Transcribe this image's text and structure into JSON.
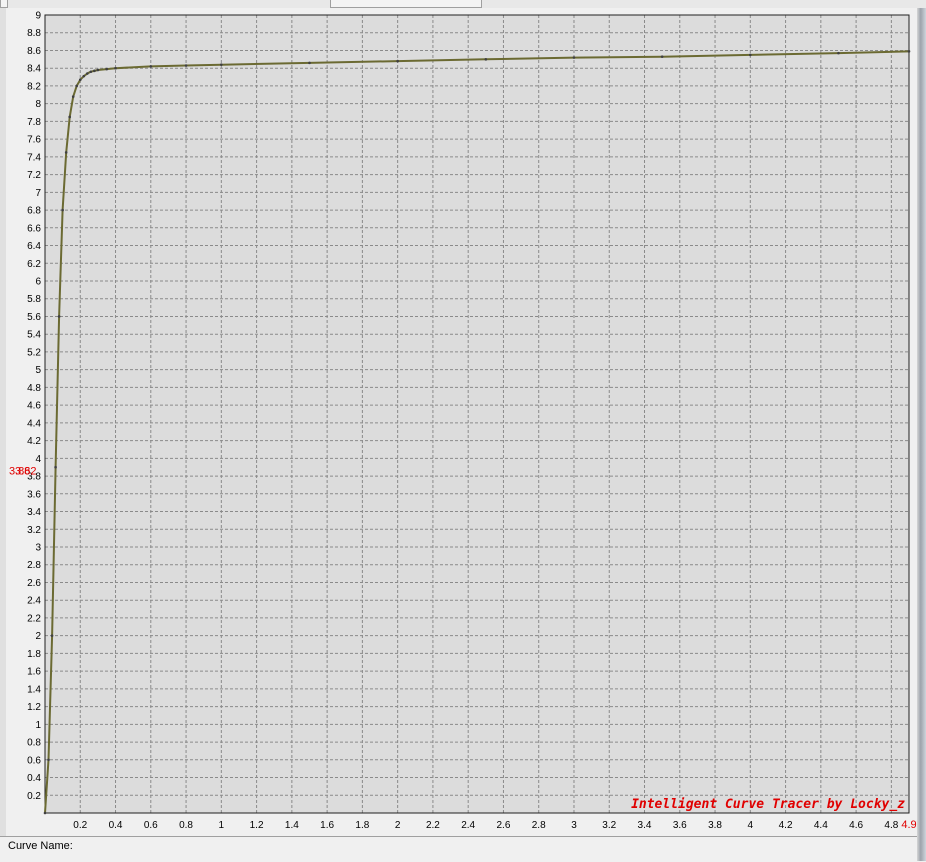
{
  "status_bar": {
    "curve_name_label": "Curve Name:",
    "curve_name_value": ""
  },
  "watermark": "Intelligent Curve Tracer by Locky_z",
  "cursor_readout": {
    "y_value": "3.862",
    "y_overlap_text": "3.8",
    "x_value": "4.9"
  },
  "colors": {
    "plot_bg": "#dcdcdc",
    "grid": "#8a8a8a",
    "curve": "#6b6a32",
    "curve_point": "#404040",
    "marker_text": "#e00000"
  },
  "chart_data": {
    "type": "line",
    "title": "",
    "xlabel": "",
    "ylabel": "",
    "xlim": [
      0,
      4.9
    ],
    "ylim": [
      0,
      9
    ],
    "grid": true,
    "x_ticks": [
      "0.2",
      "0.4",
      "0.6",
      "0.8",
      "1",
      "1.2",
      "1.4",
      "1.6",
      "1.8",
      "2",
      "2.2",
      "2.4",
      "2.6",
      "2.8",
      "3",
      "3.2",
      "3.4",
      "3.6",
      "3.8",
      "4",
      "4.2",
      "4.4",
      "4.6",
      "4.8"
    ],
    "y_ticks": [
      "0.2",
      "0.4",
      "0.6",
      "0.8",
      "1",
      "1.2",
      "1.4",
      "1.6",
      "1.8",
      "2",
      "2.2",
      "2.4",
      "2.6",
      "2.8",
      "3",
      "3.2",
      "3.4",
      "3.6",
      "3.8",
      "4",
      "4.2",
      "4.4",
      "4.6",
      "4.8",
      "5",
      "5.2",
      "5.4",
      "5.6",
      "5.8",
      "6",
      "6.2",
      "6.4",
      "6.6",
      "6.8",
      "7",
      "7.2",
      "7.4",
      "7.6",
      "7.8",
      "8",
      "8.2",
      "8.4",
      "8.6",
      "8.8",
      "9"
    ],
    "series": [
      {
        "x": [
          0,
          0.02,
          0.04,
          0.06,
          0.08,
          0.1,
          0.12,
          0.14,
          0.16,
          0.18,
          0.2,
          0.22,
          0.24,
          0.26,
          0.28,
          0.3,
          0.35,
          0.4,
          0.6,
          0.8,
          1.0,
          1.5,
          2.0,
          2.5,
          3.0,
          3.5,
          4.0,
          4.5,
          4.9
        ],
        "y": [
          0,
          0.6,
          2.0,
          3.9,
          5.6,
          6.8,
          7.45,
          7.85,
          8.08,
          8.2,
          8.27,
          8.31,
          8.34,
          8.36,
          8.37,
          8.38,
          8.39,
          8.4,
          8.42,
          8.43,
          8.44,
          8.46,
          8.48,
          8.5,
          8.52,
          8.53,
          8.55,
          8.57,
          8.59
        ]
      }
    ]
  }
}
